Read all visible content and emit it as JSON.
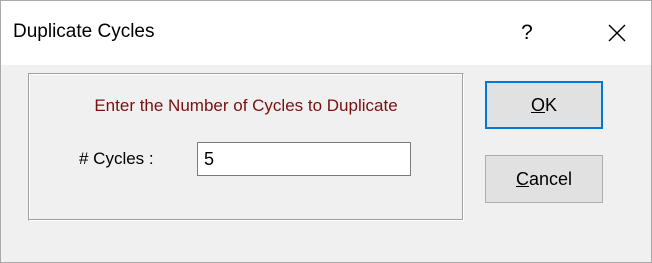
{
  "window": {
    "title": "Duplicate Cycles",
    "help_label": "?",
    "close_icon": "close-icon"
  },
  "form": {
    "prompt": "Enter the Number of Cycles to Duplicate",
    "cycles_label": "# Cycles :",
    "cycles_value": "5"
  },
  "buttons": {
    "ok_mnemonic": "O",
    "ok_rest": "K",
    "cancel_mnemonic": "C",
    "cancel_rest": "ancel"
  },
  "colors": {
    "prompt_text": "#7b1010",
    "default_button_border": "#0078d7"
  }
}
